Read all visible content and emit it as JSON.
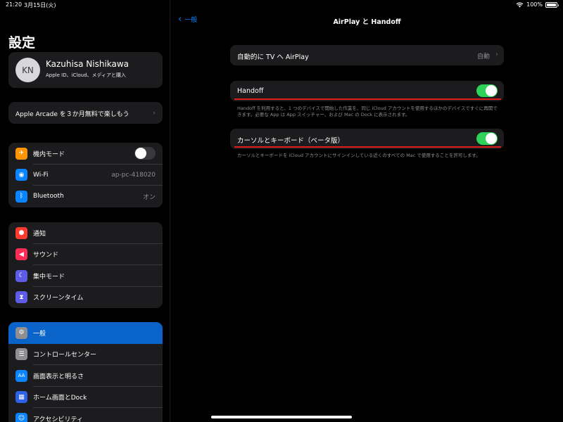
{
  "status": {
    "time": "21:20",
    "date": "3月15日(火)",
    "battery": "100%",
    "battery_level": 1.0,
    "wifi_icon": "wifi-icon"
  },
  "sidebar": {
    "title": "設定",
    "profile": {
      "initials": "KN",
      "name": "Kazuhisa Nishikawa",
      "subtitle": "Apple ID、iCloud、メディアと購入"
    },
    "arcade": "Apple Arcade を３か月無料で楽しもう",
    "group1": [
      {
        "label": "機内モード",
        "icon": "airplane-icon",
        "glyph": "✈",
        "color": "#ff9500",
        "toggle": false
      },
      {
        "label": "Wi-Fi",
        "icon": "wifi-icon",
        "glyph": "◉",
        "color": "#0a84ff",
        "value": "ap-pc-418020"
      },
      {
        "label": "Bluetooth",
        "icon": "bluetooth-icon",
        "glyph": "ᛒ",
        "color": "#0a84ff",
        "value": "オン"
      }
    ],
    "group2": [
      {
        "label": "通知",
        "icon": "notifications-icon",
        "glyph": "●",
        "color": "#ff3b30"
      },
      {
        "label": "サウンド",
        "icon": "sound-icon",
        "glyph": "◀",
        "color": "#ff2d55"
      },
      {
        "label": "集中モード",
        "icon": "moon-icon",
        "glyph": "☾",
        "color": "#5e5ce6"
      },
      {
        "label": "スクリーンタイム",
        "icon": "hourglass-icon",
        "glyph": "⧗",
        "color": "#5e5ce6"
      }
    ],
    "group3": [
      {
        "label": "一般",
        "icon": "gear-icon",
        "glyph": "⚙",
        "color": "#8e8e93",
        "selected": true
      },
      {
        "label": "コントロールセンター",
        "icon": "control-center-icon",
        "glyph": "☰",
        "color": "#8e8e93"
      },
      {
        "label": "画面表示と明るさ",
        "icon": "display-brightness-icon",
        "glyph": "AA",
        "color": "#0a84ff"
      },
      {
        "label": "ホーム画面とDock",
        "icon": "home-screen-icon",
        "glyph": "▦",
        "color": "#2c62e8"
      },
      {
        "label": "アクセシビリティ",
        "icon": "accessibility-icon",
        "glyph": "☺",
        "color": "#0a84ff"
      }
    ]
  },
  "detail": {
    "back_label": "一般",
    "title": "AirPlay と Handoff",
    "airplay": {
      "label": "自動的に TV へ AirPlay",
      "value": "自動"
    },
    "handoff": {
      "label": "Handoff",
      "on": true,
      "note": "Handoff を利用すると、1 つのデバイスで開始した作業を、同じ iCloud アカウントを使用するほかのデバイスですぐに再開できます。必要な App は App スイッチャー、および Mac の Dock に表示されます。"
    },
    "cursor": {
      "label": "カーソルとキーボード（ベータ版）",
      "on": true,
      "note": "カーソルとキーボードを iCloud アカウントにサインインしている近くのすべての Mac で使用することを許可します。"
    },
    "accent_color": "#0a84ff",
    "toggle_on_color": "#30d158",
    "annotation_color": "#e21b1b"
  }
}
